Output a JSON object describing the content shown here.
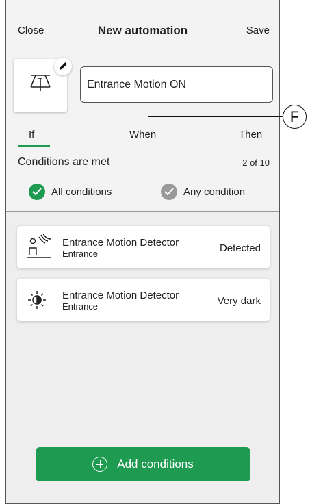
{
  "header": {
    "close_label": "Close",
    "title": "New automation",
    "save_label": "Save"
  },
  "automation": {
    "icon": "ceiling-lamp-icon",
    "edit_icon": "pencil-icon",
    "name_value": "Entrance Motion ON"
  },
  "tabs": [
    {
      "label": "If",
      "active": true
    },
    {
      "label": "When",
      "active": false
    },
    {
      "label": "Then",
      "active": false
    }
  ],
  "conditions": {
    "label": "Conditions are met",
    "count": "2 of 10",
    "options": [
      {
        "label": "All conditions",
        "selected": true
      },
      {
        "label": "Any condition",
        "selected": false
      }
    ]
  },
  "cards": [
    {
      "icon": "motion-sensor-icon",
      "title": "Entrance Motion Detector",
      "subtitle": "Entrance",
      "value": "Detected"
    },
    {
      "icon": "brightness-icon",
      "title": "Entrance Motion Detector",
      "subtitle": "Entrance",
      "value": "Very dark"
    }
  ],
  "add_button": {
    "icon": "plus-circle-icon",
    "label": "Add conditions"
  },
  "callout": {
    "label": "F"
  },
  "colors": {
    "accent": "#1e9b50",
    "disabled": "#9a9a9a",
    "panel": "#f3f3f3",
    "background": "#eeeeee"
  }
}
